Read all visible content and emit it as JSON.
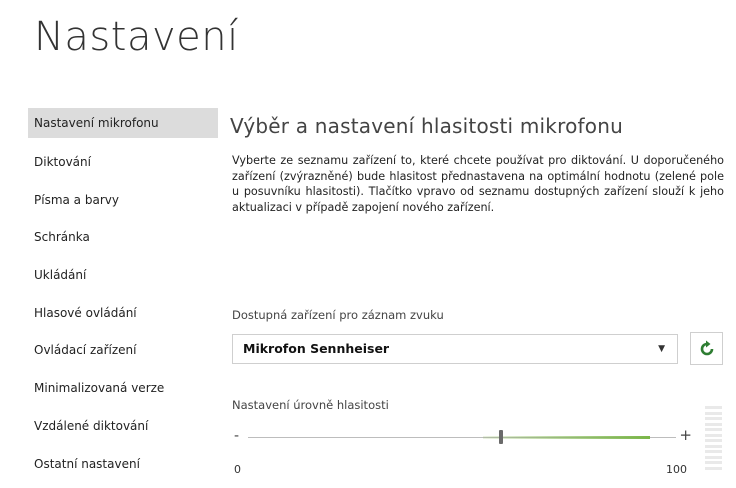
{
  "title": "Nastavení",
  "sidebar": {
    "items": [
      {
        "label": "Nastavení mikrofonu",
        "active": true
      },
      {
        "label": "Diktování"
      },
      {
        "label": "Písma a barvy"
      },
      {
        "label": "Schránka"
      },
      {
        "label": "Ukládání"
      },
      {
        "label": "Hlasové ovládání"
      },
      {
        "label": "Ovládací zařízení"
      },
      {
        "label": "Minimalizovaná verze"
      },
      {
        "label": "Vzdálené diktování"
      },
      {
        "label": "Ostatní nastavení"
      }
    ]
  },
  "main": {
    "section_title": "Výběr a nastavení hlasitosti mikrofonu",
    "description": "Vyberte ze seznamu zařízení to, které chcete používat pro diktování. U doporučeného zařízení (zvýrazněné) bude hlasitost přednastavena na optimální hodnotu (zelené pole u posuvníku hlasitosti). Tlačítko vpravo od seznamu dostupných zařízení slouží k jeho aktualizaci v případě zapojení nového zařízení.",
    "devices_label": "Dostupná zařízení pro záznam zvuku",
    "selected_device": "Mikrofon Sennheiser",
    "refresh_icon": "refresh-icon",
    "volume_label": "Nastavení úrovně hlasitosti",
    "slider": {
      "min_symbol": "-",
      "max_symbol": "+",
      "min_label": "0",
      "max_label": "100",
      "value": 59,
      "recommended_start": 55,
      "recommended_end": 94
    },
    "colors": {
      "accent_green": "#2e7d32",
      "recommended": "#7ab648",
      "active_item_bg": "#dcdcdc"
    }
  }
}
